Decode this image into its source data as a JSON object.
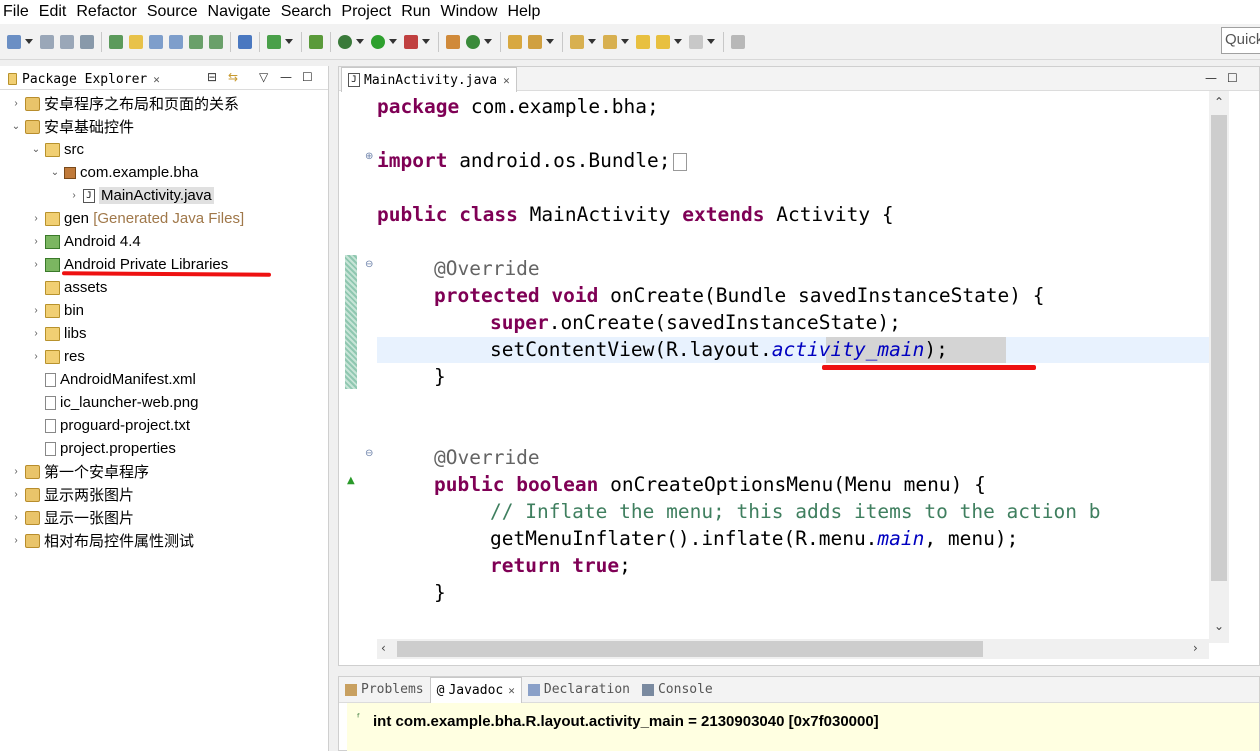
{
  "menubar": {
    "items": [
      "File",
      "Edit",
      "Refactor",
      "Source",
      "Navigate",
      "Search",
      "Project",
      "Run",
      "Window",
      "Help"
    ]
  },
  "toolbar": {
    "quick_access_placeholder": "Quick"
  },
  "package_explorer": {
    "title": "Package Explorer",
    "tree": [
      {
        "label": "安卓程序之布局和页面的关系",
        "expanded": false
      },
      {
        "label": "安卓基础控件",
        "expanded": true
      },
      {
        "label": "src",
        "expanded": true
      },
      {
        "label": "com.example.bha",
        "expanded": true
      },
      {
        "label": "MainActivity.java",
        "expanded": false
      },
      {
        "label": "gen",
        "suffix": "[Generated Java Files]"
      },
      {
        "label": "Android 4.4"
      },
      {
        "label": "Android Private Libraries"
      },
      {
        "label": "assets"
      },
      {
        "label": "bin"
      },
      {
        "label": "libs"
      },
      {
        "label": "res"
      },
      {
        "label": "AndroidManifest.xml"
      },
      {
        "label": "ic_launcher-web.png"
      },
      {
        "label": "proguard-project.txt"
      },
      {
        "label": "project.properties"
      },
      {
        "label": "第一个安卓程序",
        "expanded": false
      },
      {
        "label": "显示两张图片",
        "expanded": false
      },
      {
        "label": "显示一张图片",
        "expanded": false
      },
      {
        "label": "相对布局控件属性测试",
        "expanded": false
      }
    ]
  },
  "editor": {
    "tab_title": "MainActivity.java",
    "lines": {
      "l1_kw": "package",
      "l1_rest": " com.example.bha;",
      "l2_kw": "import",
      "l2_rest": " android.os.Bundle;",
      "l3_kw1": "public",
      "l3_kw2": "class",
      "l3_mid": " MainActivity ",
      "l3_kw3": "extends",
      "l3_rest": " Activity {",
      "l4_ann": "@Override",
      "l5_kw1": "protected",
      "l5_kw2": "void",
      "l5_rest": " onCreate(Bundle savedInstanceState) {",
      "l6_kw": "super",
      "l6_rest": ".onCreate(savedInstanceState);",
      "l7_pre": "setContentView(R.layout.",
      "l7_field": "activity_main",
      "l7_post": ");",
      "l8": "}",
      "l9_ann": "@Override",
      "l10_kw1": "public",
      "l10_kw2": "boolean",
      "l10_rest": " onCreateOptionsMenu(Menu menu) {",
      "l11_cmt": "// Inflate the menu; this adds items to the action b",
      "l12_pre": "getMenuInflater().inflate(R.menu.",
      "l12_field": "main",
      "l12_post": ", menu);",
      "l13_kw1": "return",
      "l13_kw2": "true",
      "l13_post": ";",
      "l14": "}"
    }
  },
  "bottom_panel": {
    "tabs": [
      "Problems",
      "Javadoc",
      "Declaration",
      "Console"
    ],
    "active_tab": "Javadoc",
    "javadoc_text": "int com.example.bha.R.layout.activity_main = 2130903040 [0x7f030000]"
  }
}
